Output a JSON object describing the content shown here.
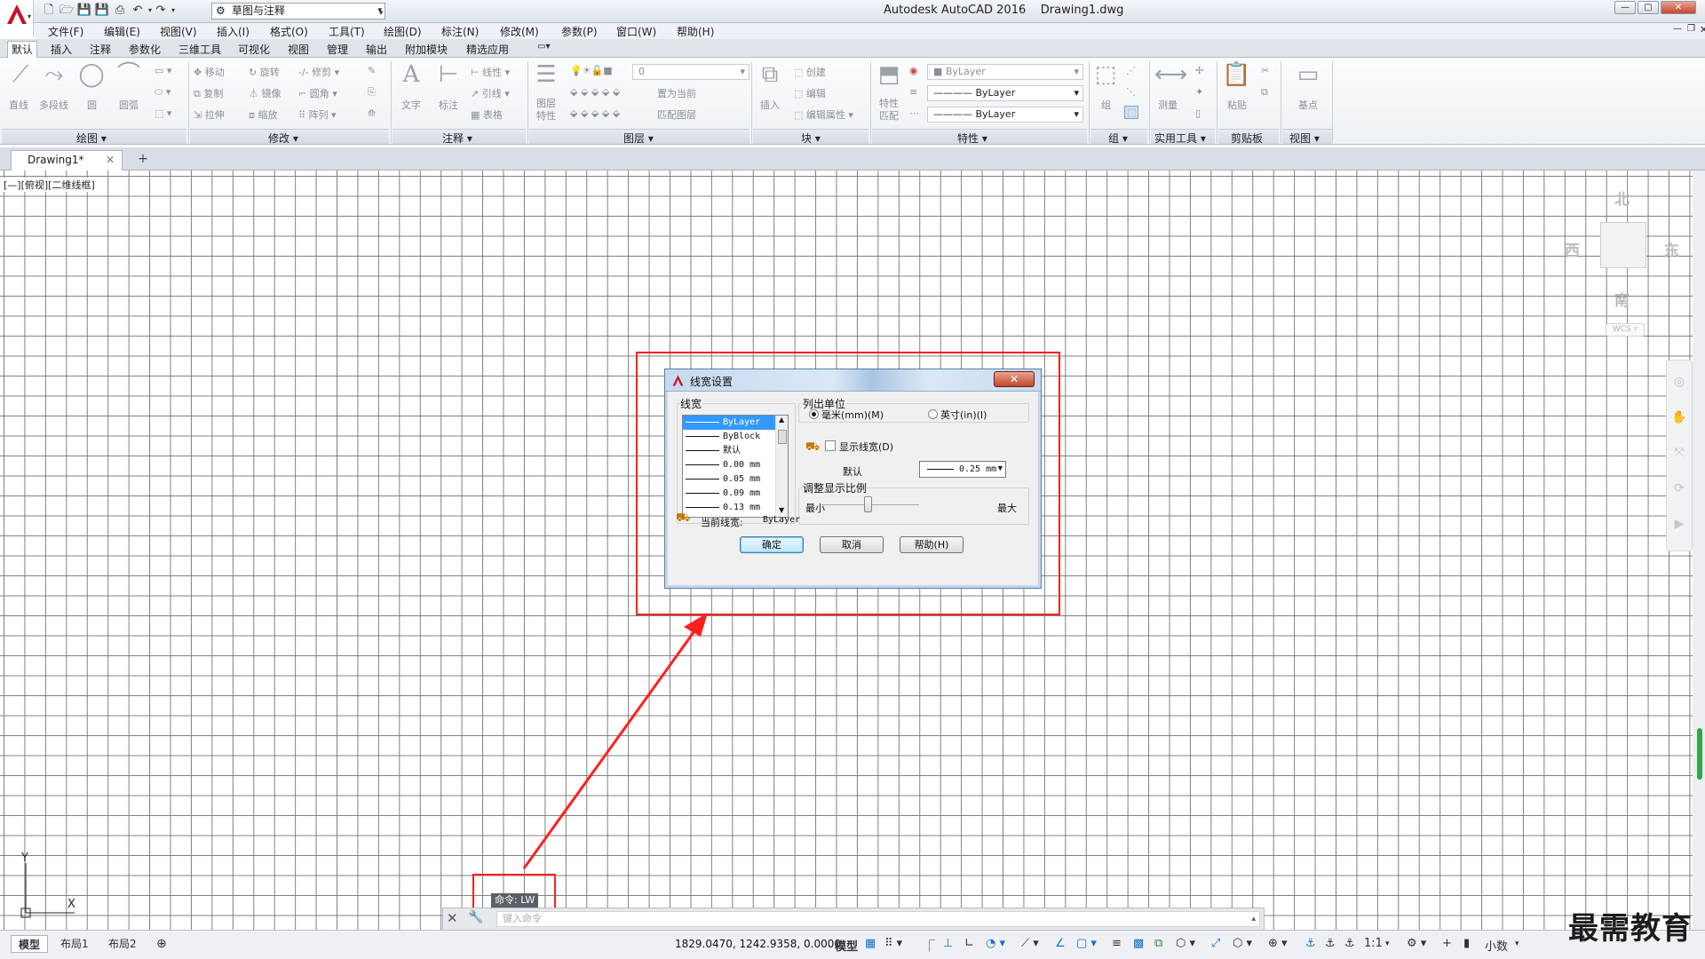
{
  "app": {
    "title": "Autodesk AutoCAD 2016    Drawing1.dwg",
    "workspace": "草图与注释",
    "window_controls": [
      "—",
      "▢",
      "✕"
    ]
  },
  "menus": [
    "文件(F)",
    "编辑(E)",
    "视图(V)",
    "插入(I)",
    "格式(O)",
    "工具(T)",
    "绘图(D)",
    "标注(N)",
    "修改(M)",
    "参数(P)",
    "窗口(W)",
    "帮助(H)"
  ],
  "ribbon_tabs": [
    "默认",
    "插入",
    "注释",
    "参数化",
    "三维工具",
    "可视化",
    "视图",
    "管理",
    "输出",
    "附加模块",
    "精选应用"
  ],
  "ribbon": {
    "draw_tools": [
      "直线",
      "多段线",
      "圆",
      "圆弧"
    ],
    "modify_tools": [
      "移动",
      "旋转",
      "修剪",
      "复制",
      "镜像",
      "圆角",
      "拉伸",
      "缩放",
      "阵列"
    ],
    "annotation_tools": [
      "文字",
      "标注",
      "线性",
      "引线",
      "表格"
    ],
    "layer_tools": [
      "图层特性",
      "置为当前",
      "匹配图层"
    ],
    "layer_value": "0",
    "block_tools": [
      "插入",
      "创建",
      "编辑",
      "编辑属性"
    ],
    "props_tools": [
      "特性匹配"
    ],
    "props_values": [
      "ByLayer",
      "ByLayer",
      "ByLayer"
    ],
    "group_tools": [
      "组"
    ],
    "util_tools": [
      "测量"
    ],
    "clip_tools": [
      "粘贴"
    ],
    "view_tools": [
      "基点"
    ],
    "panels": [
      "绘图 ▾",
      "修改 ▾",
      "注释 ▾",
      "图层 ▾",
      "块 ▾",
      "特性 ▾",
      "组 ▾",
      "实用工具 ▾",
      "剪贴板",
      "视图 ▾"
    ]
  },
  "doc_tab": "Drawing1*",
  "view_label": "[—][俯视][二维线框]",
  "compass": {
    "n": "北",
    "s": "南",
    "w": "西",
    "e": "东",
    "wcs": "WCS ▿"
  },
  "dialog": {
    "title": "线宽设置",
    "lw_group": "线宽",
    "lineweights": [
      "ByLayer",
      "ByBlock",
      "默认",
      "0.00 mm",
      "0.05 mm",
      "0.09 mm",
      "0.13 mm"
    ],
    "selected_index": 0,
    "units_group": "列出单位",
    "unit_mm": "毫米(mm)(M)",
    "unit_in": "英寸(in)(I)",
    "unit_selected": "mm",
    "show_lw": "显示线宽(D)",
    "show_lw_checked": false,
    "default_label": "默认",
    "default_value": "0.25 mm",
    "scale_group": "调整显示比例",
    "min_label": "最小",
    "max_label": "最大",
    "current_label": "当前线宽:",
    "current_value": "ByLayer",
    "ok": "确定",
    "cancel": "取消",
    "help": "帮助(H)"
  },
  "command": {
    "tip": "命令: LW",
    "placeholder": "键入命令"
  },
  "status": {
    "layouts": [
      "模型",
      "布局1",
      "布局2"
    ],
    "coords": "1829.0470, 1242.9358, 0.0000",
    "model": "模型",
    "scale": "1:1",
    "units": "小数"
  },
  "ucs": {
    "x": "X",
    "y": "Y"
  },
  "watermark": "最需教育",
  "colors": {
    "highlight": "#ff1f1f",
    "accent": "#3399ff",
    "logo": "#c8102e"
  }
}
